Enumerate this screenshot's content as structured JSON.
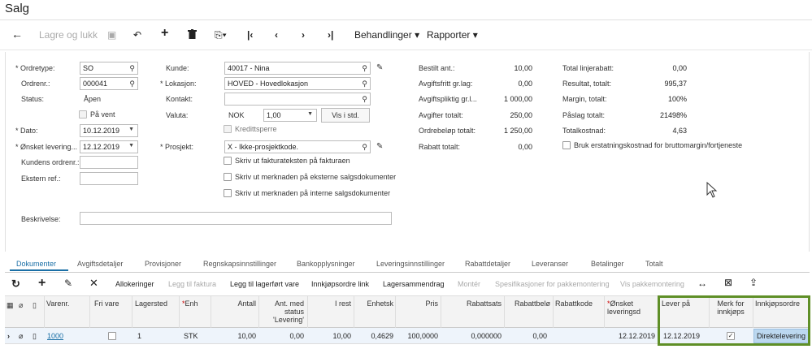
{
  "title": "Salg",
  "toolbar": {
    "save_close": "Lagre og lukk",
    "actions": "Behandlinger",
    "reports": "Rapporter"
  },
  "form": {
    "ordretype_label": "Ordretype:",
    "ordretype_value": "SO",
    "ordrenr_label": "Ordrenr.:",
    "ordrenr_value": "000041",
    "status_label": "Status:",
    "status_value": "Åpen",
    "paa_vent_label": "På vent",
    "dato_label": "Dato:",
    "dato_value": "10.12.2019",
    "onsket_label": "Ønsket levering...",
    "onsket_value": "12.12.2019",
    "kundens_label": "Kundens ordrenr.:",
    "kundens_value": "",
    "ekstern_label": "Ekstern ref.:",
    "ekstern_value": "",
    "beskrivelse_label": "Beskrivelse:",
    "beskrivelse_value": "",
    "kunde_label": "Kunde:",
    "kunde_value": "40017 - Nina",
    "lokasjon_label": "Lokasjon:",
    "lokasjon_value": "HOVED - Hovedlokasjon",
    "kontakt_label": "Kontakt:",
    "kontakt_value": "",
    "valuta_label": "Valuta:",
    "valuta_code": "NOK",
    "valuta_rate": "1,00",
    "vis_i_std": "Vis i std.",
    "kredittsperre": "Kredittsperre",
    "prosjekt_label": "Prosjekt:",
    "prosjekt_value": "X - Ikke-prosjektkode.",
    "cb1": "Skriv ut fakturateksten på fakturaen",
    "cb2": "Skriv ut merknaden på eksterne salgsdokumenter",
    "cb3": "Skriv ut merknaden på interne salgsdokumenter"
  },
  "totals": {
    "labels": [
      "Bestilt ant.:",
      "Avgiftsfritt gr.lag:",
      "Avgiftspliktig gr.l...",
      "Avgifter totalt:",
      "Ordrebeløp totalt:",
      "Rabatt totalt:"
    ],
    "values": [
      "10,00",
      "0,00",
      "1 000,00",
      "250,00",
      "1 250,00",
      "0,00"
    ]
  },
  "margins": {
    "labels": [
      "Total linjerabatt:",
      "Resultat, totalt:",
      "Margin, totalt:",
      "Påslag totalt:",
      "Totalkostnad:"
    ],
    "values": [
      "0,00",
      "995,37",
      "100%",
      "21498%",
      "4,63"
    ],
    "checkbox_label": "Bruk erstatningskostnad for bruttomargin/fortjeneste"
  },
  "tabs": [
    "Dokumenter",
    "Avgiftsdetaljer",
    "Provisjoner",
    "Regnskapsinnstillinger",
    "Bankopplysninger",
    "Leveringsinnstillinger",
    "Rabattdetaljer",
    "Leveranser",
    "Betalinger",
    "Totalt"
  ],
  "grid_toolbar": [
    "Allokeringer",
    "Legg til faktura",
    "Legg til lagerført vare",
    "Innkjøpsordre link",
    "Lagersammendrag",
    "Montér",
    "Spesifikasjoner for pakkemontering",
    "Vis pakkemontering"
  ],
  "columns": {
    "varenr": "Varenr.",
    "fri_vare": "Fri vare",
    "lagersted": "Lagersted",
    "enh": "Enh",
    "antall": "Antall",
    "ant_med_status": "Ant. med status 'Levering'",
    "i_rest": "I rest",
    "enhetskost": "Enhetsk",
    "pris": "Pris",
    "rabattsats": "Rabattsats",
    "rabattbelop": "Rabattbelø",
    "rabattkode": "Rabattkode",
    "onsket_leveringsdato": "Ønsket leveringsd",
    "lever_paa": "Lever på",
    "merk_for_innkjops": "Merk for innkjøps",
    "innkjopsordre": "Innkjøpsordre"
  },
  "row": {
    "varenr": "1000",
    "lagersted": "1",
    "enh": "STK",
    "antall": "10,00",
    "ant_med_status": "0,00",
    "i_rest": "10,00",
    "enhetskost": "0,4629",
    "pris": "100,0000",
    "rabattsats": "0,000000",
    "rabattbelop": "0,00",
    "onsket": "12.12.2019",
    "lever_paa": "12.12.2019",
    "innkjopsordre": "Direktelevering"
  },
  "colors": {
    "accent": "#1a6fa6",
    "highlight": "#5f8f27"
  }
}
